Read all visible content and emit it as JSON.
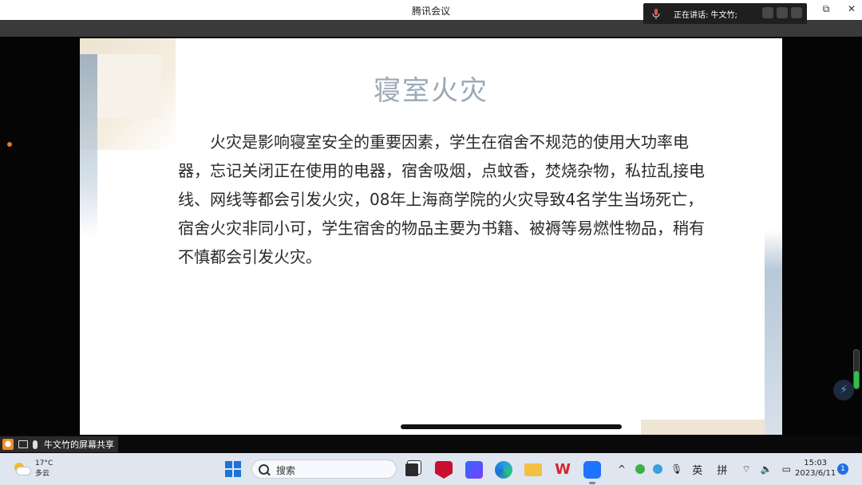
{
  "window": {
    "title": "腾讯会议",
    "controls": {
      "minimize": "—",
      "restore": "⧉",
      "close": "✕"
    }
  },
  "meeting": {
    "speaking_label": "正在讲话: 牛文竹;"
  },
  "slide": {
    "title": "寝室火灾",
    "body": "火灾是影响寝室安全的重要因素，学生在宿舍不规范的使用大功率电器，忘记关闭正在使用的电器，宿舍吸烟，点蚊香，焚烧杂物，私拉乱接电线、网线等都会引发火灾，08年上海商学院的火灾导致4名学生当场死亡，宿舍火灾非同小可，学生宿舍的物品主要为书籍、被褥等易燃性物品，稍有不慎都会引发火灾。"
  },
  "share_bar": {
    "text": "牛文竹的屏幕共享"
  },
  "volume_level": 0.45,
  "taskbar": {
    "weather": {
      "temp": "17°C",
      "condition": "多云"
    },
    "search_label": "搜索",
    "apps": [
      "task-view",
      "mcafee",
      "notes",
      "edge",
      "file-explorer",
      "wps",
      "tencent-meeting"
    ],
    "tray": {
      "chevron": "^",
      "ime_en": "英",
      "ime_pinyin": "拼"
    },
    "clock": {
      "time": "15:03",
      "date": "2023/6/11"
    },
    "notifications": "1"
  },
  "colors": {
    "slide_title": "#9aa9b6",
    "accent_blue": "#1e74ff",
    "speaking_bg": "#1f1f1f"
  }
}
